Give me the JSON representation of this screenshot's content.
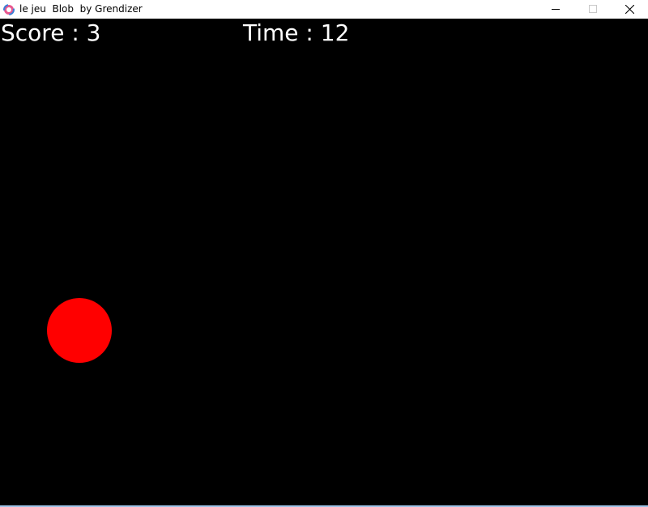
{
  "window": {
    "title": "le jeu  Blob  by Grendizer",
    "icon": "app-logo-icon"
  },
  "controls": {
    "minimize_icon": "minimize-icon",
    "maximize_icon": "maximize-icon",
    "close_icon": "close-icon"
  },
  "hud": {
    "score_text": "Score : 3",
    "time_text": "Time : 12"
  },
  "game": {
    "background_color": "#000000",
    "blob_color": "#ff0000",
    "text_color": "#ffffff"
  }
}
